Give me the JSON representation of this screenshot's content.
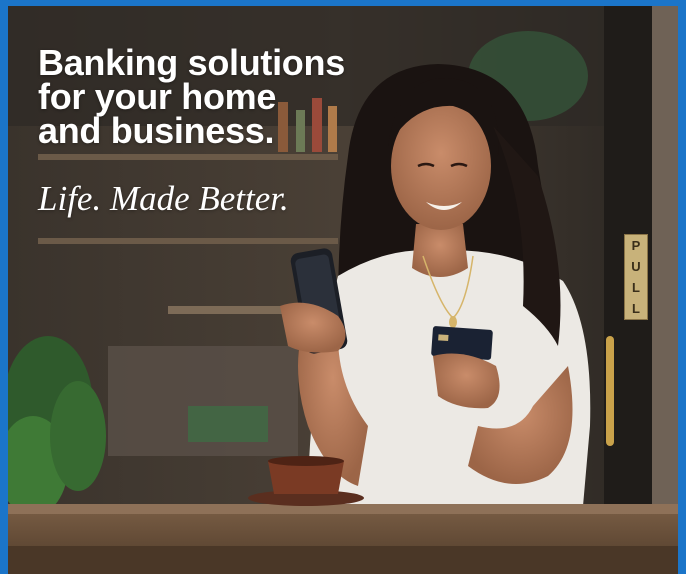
{
  "ad": {
    "headline_lines": [
      "Banking solutions",
      "for your home",
      "and business."
    ],
    "tagline": "Life. Made Better.",
    "door_sign": [
      "P",
      "U",
      "L",
      "L"
    ]
  },
  "colors": {
    "frame": "#1b75c9",
    "text": "#ffffff",
    "shirt": "#ece9e4",
    "phone": "#1c1f26",
    "card": "#1a2233"
  }
}
